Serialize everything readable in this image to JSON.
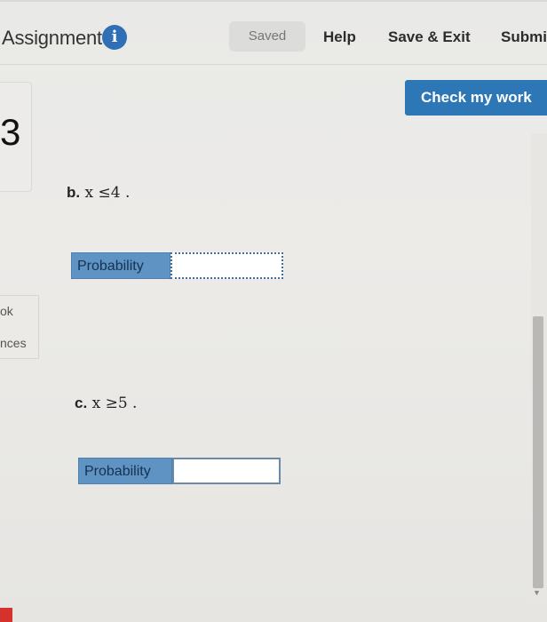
{
  "header": {
    "title": "Assignment",
    "info_icon": "info-icon",
    "saved_label": "Saved",
    "help_label": "Help",
    "save_exit_label": "Save & Exit",
    "submit_label": "Submit"
  },
  "actions": {
    "check_label": "Check my work"
  },
  "question": {
    "number": "3"
  },
  "sidebar": {
    "ebook_label": "ok",
    "references_label": "nces"
  },
  "parts": [
    {
      "letter": "b.",
      "expression": "x ≤4 .",
      "input_label": "Probability",
      "input_value": ""
    },
    {
      "letter": "c.",
      "expression": "x ≥5 .",
      "input_label": "Probability",
      "input_value": ""
    }
  ],
  "colors": {
    "accent": "#2e77b7",
    "label_bg": "#5e93c4"
  }
}
